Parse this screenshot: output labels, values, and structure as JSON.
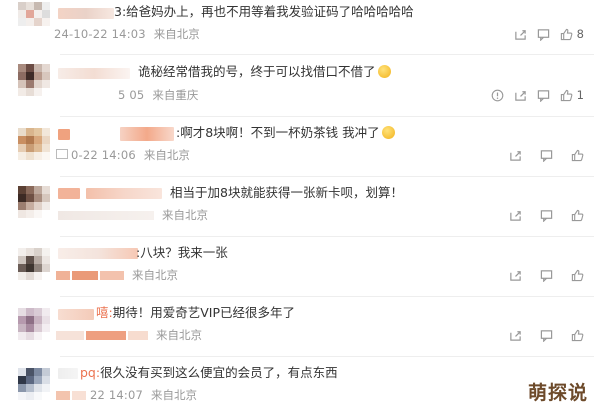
{
  "comments": [
    {
      "name_fragment": "3:",
      "text": "给爸妈办上，再也不用等着我发验证码了哈哈哈哈哈",
      "date": "24-10-22 14:03",
      "source": "来自北京",
      "likes": "8",
      "emoji": false
    },
    {
      "name_fragment": "",
      "text": "诡秘经常借我的号，终于可以找借口不借了",
      "date": "5 05",
      "source": "来自重庆",
      "likes": "1",
      "emoji": true
    },
    {
      "name_fragment": "",
      "text": ":啊才8块啊！不到一杯奶茶钱 我冲了",
      "date": "0-22 14:06",
      "source": "来自北京",
      "likes": "",
      "emoji": true
    },
    {
      "name_fragment": "",
      "text": "相当于加8块就能获得一张新卡呗，划算！",
      "date": "",
      "source": "来自北京",
      "likes": "",
      "emoji": false
    },
    {
      "name_fragment": "",
      "text": ":八块？我来一张",
      "date": "",
      "source": "来自北京",
      "likes": "",
      "emoji": false
    },
    {
      "name_fragment": "嘻:",
      "text": "期待！用爱奇艺VIP已经很多年了",
      "date": "",
      "source": "来自北京",
      "likes": "",
      "emoji": false
    },
    {
      "name_fragment": "pq:",
      "text": "很久没有买到这么便宜的会员了，有点东西",
      "date": "22 14:07",
      "source": "来自北京",
      "likes": "",
      "emoji": false
    }
  ],
  "icons": {
    "share": "share-icon",
    "comment": "comment-icon",
    "like": "like-icon",
    "report": "report-icon"
  },
  "watermark": "萌探说",
  "colors": {
    "meta": "#999999",
    "text": "#333333",
    "watermark": "#6d4a2a"
  }
}
